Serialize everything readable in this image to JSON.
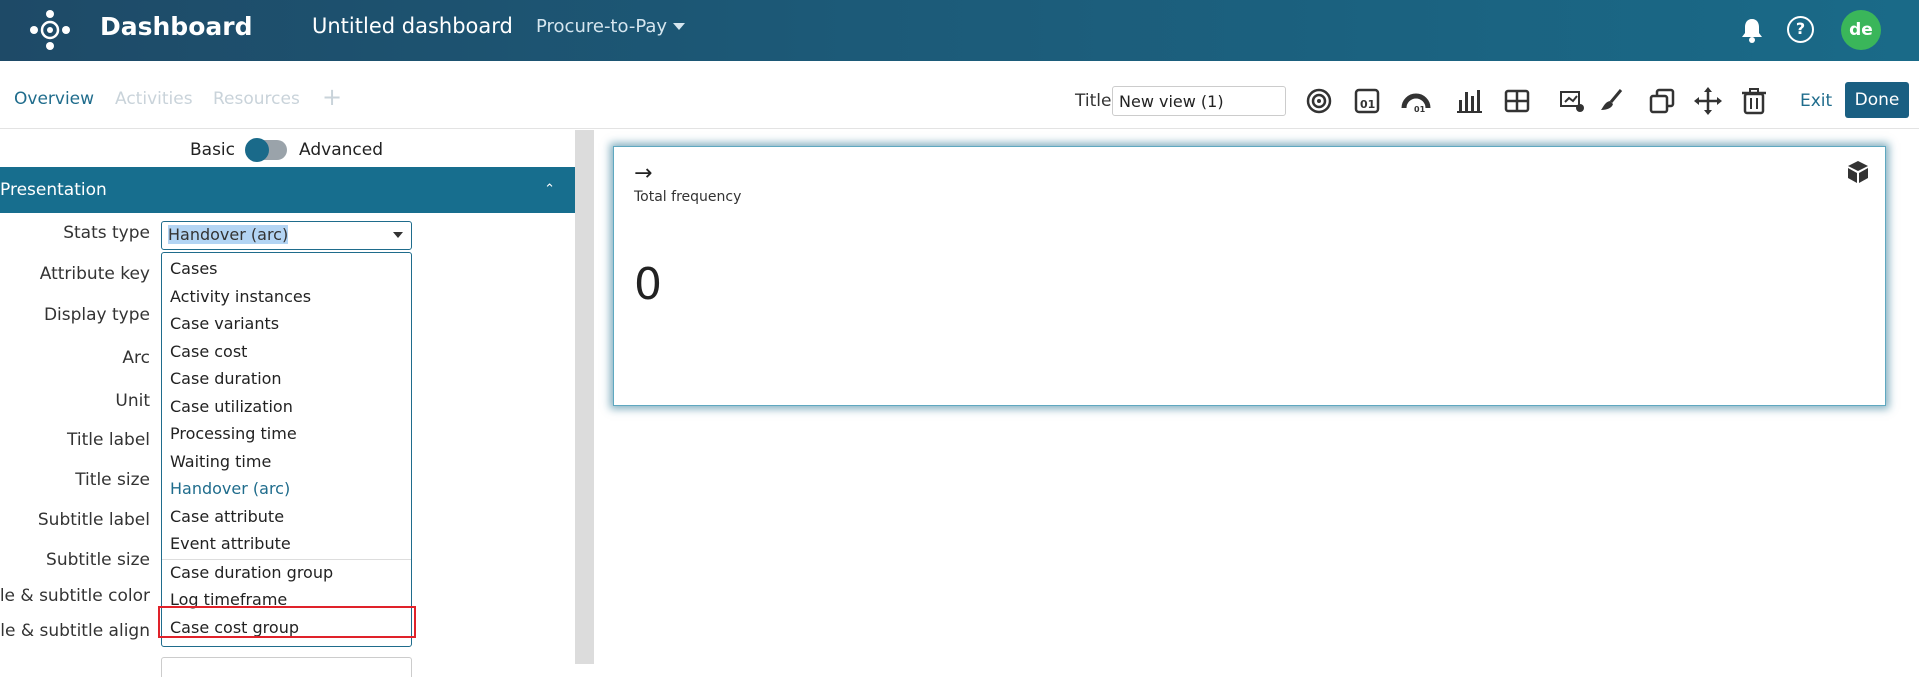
{
  "header": {
    "app_title": "Dashboard",
    "dashboard_name": "Untitled dashboard",
    "process": "Procure-to-Pay",
    "user_initials": "de",
    "help_glyph": "?"
  },
  "tabs": [
    {
      "label": "Overview"
    },
    {
      "label": "Activities"
    },
    {
      "label": "Resources"
    }
  ],
  "tab_add": "+",
  "toolbar": {
    "title_label": "Title",
    "title_value": "New view (1)",
    "exit_label": "Exit",
    "done_label": "Done"
  },
  "panel": {
    "basic_label": "Basic",
    "advanced_label": "Advanced",
    "section_title": "Presentation",
    "fields": [
      {
        "label": "Stats type"
      },
      {
        "label": "Attribute key"
      },
      {
        "label": "Display type"
      },
      {
        "label": "Arc"
      },
      {
        "label": "Unit"
      },
      {
        "label": "Title label"
      },
      {
        "label": "Title size"
      },
      {
        "label": "Subtitle label"
      },
      {
        "label": "Subtitle size"
      },
      {
        "label": "Title & subtitle color"
      },
      {
        "label": "Title & subtitle align"
      }
    ],
    "stats_type_value": "Handover (arc)",
    "options": [
      "Cases",
      "Activity instances",
      "Case variants",
      "Case cost",
      "Case duration",
      "Case utilization",
      "Processing time",
      "Waiting time",
      "Handover (arc)",
      "Case attribute",
      "Event attribute",
      "Case duration group",
      "Log timeframe",
      "Case cost group"
    ]
  },
  "widget": {
    "arrow": "→",
    "label": "Total frequency",
    "value": "0"
  },
  "colors": {
    "accent": "#1f6c8c",
    "highlight_border": "#e0222a",
    "avatar": "#3ab65a"
  }
}
